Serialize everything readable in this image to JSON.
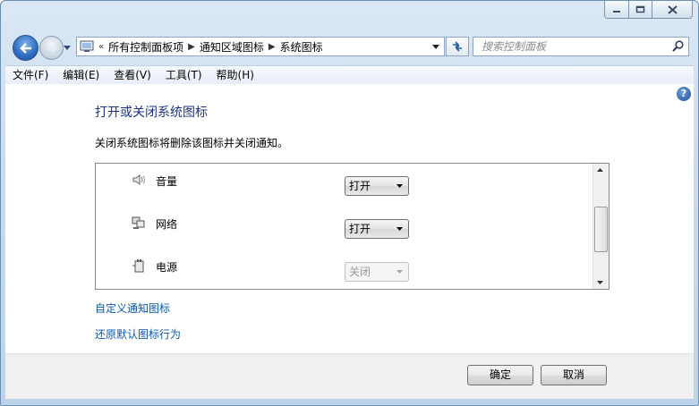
{
  "window": {
    "caption_buttons": [
      "minimize",
      "maximize",
      "close"
    ]
  },
  "navigation": {
    "address_prefix": "«",
    "breadcrumbs": [
      "所有控制面板项",
      "通知区域图标",
      "系统图标"
    ],
    "search_placeholder": "搜索控制面板"
  },
  "menu": [
    "文件(F)",
    "编辑(E)",
    "查看(V)",
    "工具(T)",
    "帮助(H)"
  ],
  "content": {
    "title": "打开或关闭系统图标",
    "description": "关闭系统图标将删除该图标并关闭通知。",
    "icons": [
      {
        "name": "音量",
        "icon": "speaker-icon",
        "value": "打开",
        "enabled": true
      },
      {
        "name": "网络",
        "icon": "network-icon",
        "value": "打开",
        "enabled": true
      },
      {
        "name": "电源",
        "icon": "power-icon",
        "value": "关闭",
        "enabled": false
      }
    ],
    "links": [
      "自定义通知图标",
      "还原默认图标行为"
    ]
  },
  "footer": {
    "ok": "确定",
    "cancel": "取消"
  },
  "colors": {
    "title": "#1e3287",
    "link": "#0a58b6"
  }
}
